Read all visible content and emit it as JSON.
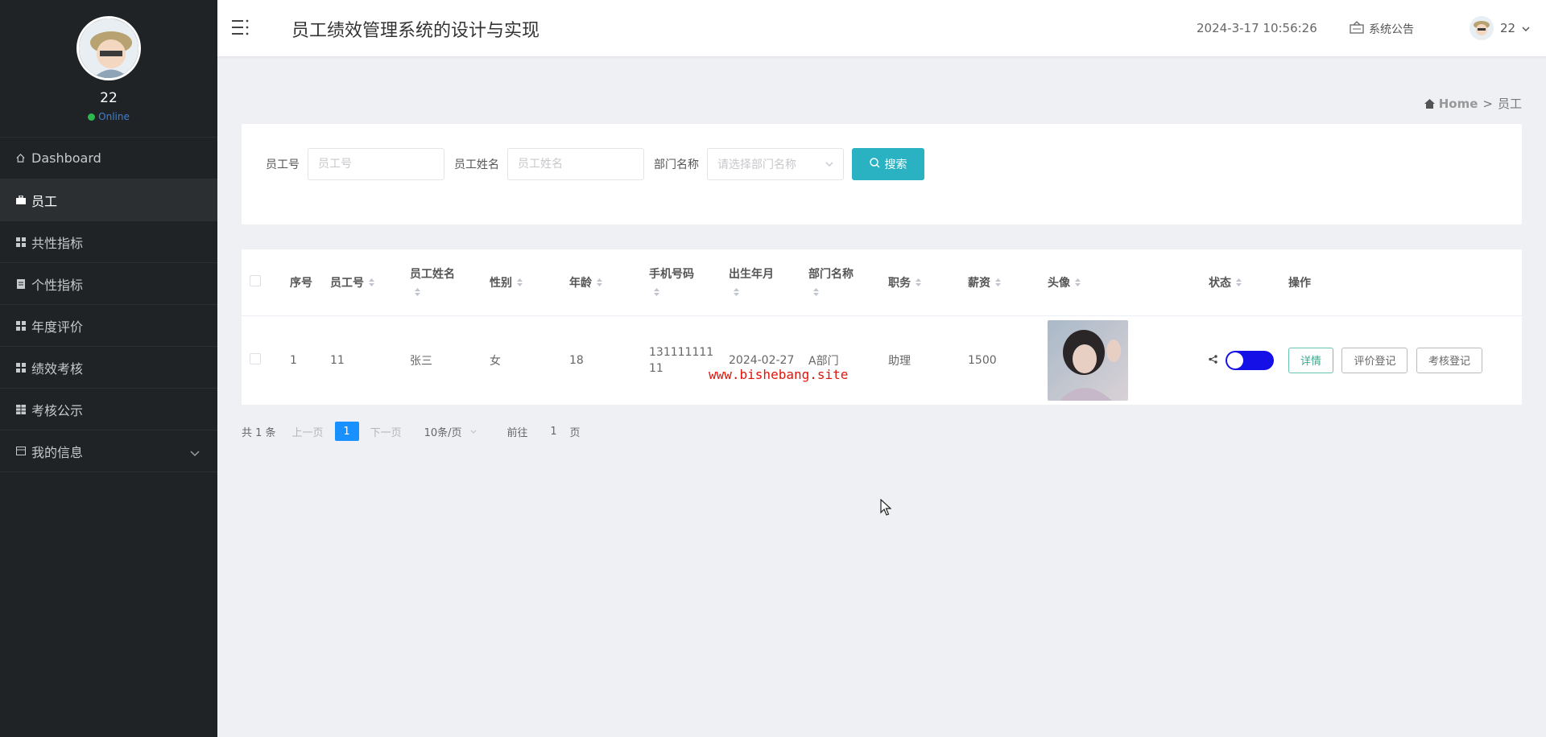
{
  "sidebar": {
    "username": "22",
    "status": "Online",
    "items": [
      {
        "label": "Dashboard",
        "icon": "home-icon"
      },
      {
        "label": "员工",
        "icon": "briefcase-icon"
      },
      {
        "label": "共性指标",
        "icon": "grid-icon"
      },
      {
        "label": "个性指标",
        "icon": "document-icon"
      },
      {
        "label": "年度评价",
        "icon": "grid-icon"
      },
      {
        "label": "绩效考核",
        "icon": "grid-icon"
      },
      {
        "label": "考核公示",
        "icon": "table-icon"
      },
      {
        "label": "我的信息",
        "icon": "card-icon"
      }
    ]
  },
  "header": {
    "title": "员工绩效管理系统的设计与实现",
    "datetime": "2024-3-17 10:56:26",
    "notice_label": "系统公告",
    "user": "22"
  },
  "breadcrumb": {
    "home": "Home",
    "sep": ">",
    "current": "员工"
  },
  "search": {
    "emp_no_label": "员工号",
    "emp_no_placeholder": "员工号",
    "emp_name_label": "员工姓名",
    "emp_name_placeholder": "员工姓名",
    "dept_label": "部门名称",
    "dept_placeholder": "请选择部门名称",
    "button": "搜索"
  },
  "table": {
    "headers": [
      "序号",
      "员工号",
      "员工姓名",
      "性别",
      "年龄",
      "手机号码",
      "出生年月",
      "部门名称",
      "职务",
      "薪资",
      "头像",
      "状态",
      "操作"
    ],
    "rows": [
      {
        "index": "1",
        "emp_no": "11",
        "name": "张三",
        "gender": "女",
        "age": "18",
        "phone_line1": "131111111",
        "phone_line2": "11",
        "birth": "2024-02-27",
        "dept": "A部门",
        "position": "助理",
        "salary": "1500",
        "status_on": true
      }
    ],
    "actions": {
      "detail": "详情",
      "evaluate": "评价登记",
      "assess": "考核登记"
    },
    "watermark": "www.bishebang.site"
  },
  "pager": {
    "total": "共 1 条",
    "prev": "上一页",
    "page": "1",
    "next": "下一页",
    "size": "10条/页",
    "goto": "前往",
    "goto_value": "1",
    "page_unit": "页"
  },
  "colors": {
    "accent": "#2bb2c2",
    "sidebar": "#1f2325",
    "toggle": "#1410e6",
    "pager": "#1890ff"
  }
}
